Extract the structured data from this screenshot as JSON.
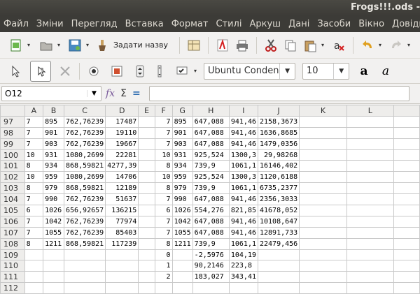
{
  "window": {
    "title": "Frogs!!!.ods -"
  },
  "menu": [
    "Файл",
    "Зміни",
    "Перегляд",
    "Вставка",
    "Формат",
    "Стилі",
    "Аркуш",
    "Дані",
    "Засоби",
    "Вікно",
    "Довідка"
  ],
  "toolbar": {
    "name_label": "Задати назву"
  },
  "format": {
    "font_name": "Ubuntu Conden",
    "font_size": "10"
  },
  "formula": {
    "cell_ref": "O12",
    "fx": "fx",
    "sum": "Σ",
    "eq": "="
  },
  "columns": [
    "",
    "A",
    "B",
    "C",
    "D",
    "E",
    "F",
    "G",
    "H",
    "I",
    "J",
    "K",
    "L"
  ],
  "rows": [
    {
      "n": "97",
      "c": [
        "7",
        "895",
        "762,76239",
        "17487",
        "",
        "7",
        "895",
        "647,088",
        "941,46",
        "2158,3673"
      ]
    },
    {
      "n": "98",
      "c": [
        "7",
        "901",
        "762,76239",
        "19110",
        "",
        "7",
        "901",
        "647,088",
        "941,46",
        "1636,8685"
      ]
    },
    {
      "n": "99",
      "c": [
        "7",
        "903",
        "762,76239",
        "19667",
        "",
        "7",
        "903",
        "647,088",
        "941,46",
        "1479,0356"
      ]
    },
    {
      "n": "100",
      "c": [
        "10",
        "931",
        "1080,2699",
        "22281",
        "",
        "10",
        "931",
        "925,524",
        "1300,3",
        "29,98268"
      ]
    },
    {
      "n": "101",
      "c": [
        "8",
        "934",
        "868,59821",
        "4277,39",
        "",
        "8",
        "934",
        "739,9",
        "1061,1",
        "16146,402"
      ]
    },
    {
      "n": "102",
      "c": [
        "10",
        "959",
        "1080,2699",
        "14706",
        "",
        "10",
        "959",
        "925,524",
        "1300,3",
        "1120,6188"
      ]
    },
    {
      "n": "103",
      "c": [
        "8",
        "979",
        "868,59821",
        "12189",
        "",
        "8",
        "979",
        "739,9",
        "1061,1",
        "6735,2377"
      ]
    },
    {
      "n": "104",
      "c": [
        "7",
        "990",
        "762,76239",
        "51637",
        "",
        "7",
        "990",
        "647,088",
        "941,46",
        "2356,3033"
      ]
    },
    {
      "n": "105",
      "c": [
        "6",
        "1026",
        "656,92657",
        "136215",
        "",
        "6",
        "1026",
        "554,276",
        "821,85",
        "41678,052"
      ]
    },
    {
      "n": "106",
      "c": [
        "7",
        "1042",
        "762,76239",
        "77974",
        "",
        "7",
        "1042",
        "647,088",
        "941,46",
        "10108,647"
      ]
    },
    {
      "n": "107",
      "c": [
        "7",
        "1055",
        "762,76239",
        "85403",
        "",
        "7",
        "1055",
        "647,088",
        "941,46",
        "12891,733"
      ]
    },
    {
      "n": "108",
      "c": [
        "8",
        "1211",
        "868,59821",
        "117239",
        "",
        "8",
        "1211",
        "739,9",
        "1061,1",
        "22479,456"
      ]
    },
    {
      "n": "109",
      "c": [
        "",
        "",
        "",
        "",
        "",
        "0",
        "",
        "-2,5976",
        "104,19",
        ""
      ]
    },
    {
      "n": "110",
      "c": [
        "",
        "",
        "",
        "",
        "",
        "1",
        "",
        "90,2146",
        "223,8",
        ""
      ]
    },
    {
      "n": "111",
      "c": [
        "",
        "",
        "",
        "",
        "",
        "2",
        "",
        "183,027",
        "343,41",
        ""
      ]
    },
    {
      "n": "112",
      "c": [
        "",
        "",
        "",
        "",
        "",
        "",
        "",
        "",
        "",
        ""
      ]
    }
  ]
}
